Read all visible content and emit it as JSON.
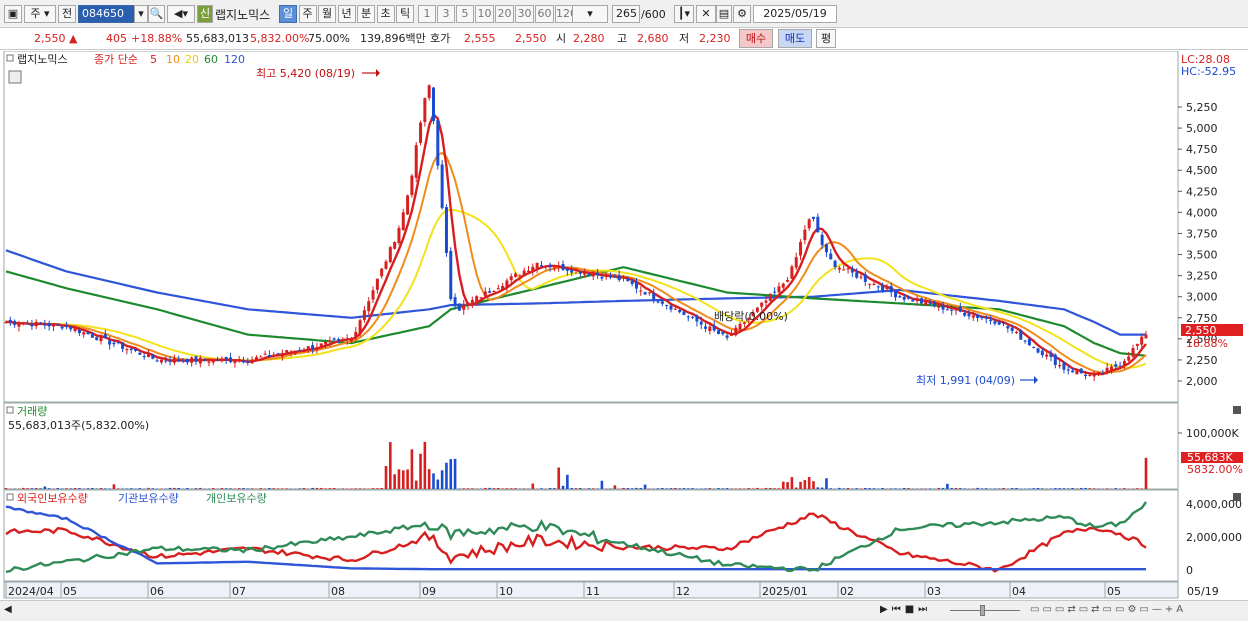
{
  "toolbar": {
    "market": "주",
    "prev": "전",
    "stock_code": "084650",
    "new_badge": "신",
    "stock_name": "랩지노믹스",
    "periods": [
      "일",
      "주",
      "월",
      "년",
      "분",
      "초",
      "틱"
    ],
    "selected_period": "일",
    "intervals": [
      "1",
      "3",
      "5",
      "10",
      "20",
      "30",
      "60",
      "120"
    ],
    "count": "265",
    "count_max": "/600",
    "date": "2025/05/19"
  },
  "quote": {
    "price": "2,550",
    "arrow": "▲",
    "change": "405",
    "change_pct": "+18.88%",
    "volume": "55,683,013",
    "volume_pct": "5,832.00%",
    "ratio": "75.00%",
    "amount": "139,896백만",
    "bid_label": "호가",
    "bid1": "2,555",
    "bid2": "2,550",
    "open_label": "시",
    "open": "2,280",
    "high_label": "고",
    "high": "2,680",
    "low_label": "저",
    "low": "2,230",
    "buy_label": "매수",
    "sell_label": "매도",
    "avg_label": "평"
  },
  "price_panel": {
    "stock_label": "랩지노믹스",
    "series_label": "종가 단순",
    "ma_labels": [
      "5",
      "10",
      "20",
      "60",
      "120"
    ],
    "lc": "LC:28.08",
    "hc": "HC:-52.95",
    "high_annot": "최고 5,420 (08/19)",
    "low_annot": "최저 1,991 (04/09)",
    "div_annot": "배당락(0.00%)",
    "current_price_tag": "2,550",
    "current_pct_tag": "18.88%",
    "y_ticks": [
      "5,250",
      "5,000",
      "4,750",
      "4,500",
      "4,250",
      "4,000",
      "3,750",
      "3,500",
      "3,250",
      "3,000",
      "2,750",
      "2,500",
      "2,250",
      "2,000"
    ]
  },
  "volume_panel": {
    "label": "거래량",
    "value_label": "55,683,013주(5,832.00%)",
    "y_tick": "100,000K",
    "tag_value": "55,683K",
    "tag_pct": "5832.00%"
  },
  "holding_panel": {
    "labels": [
      "외국인보유수량",
      "기관보유수량",
      "개인보유수량"
    ],
    "y_ticks": [
      "4,000,000",
      "2,000,000",
      "0"
    ]
  },
  "x_axis": {
    "labels": [
      "2024/04",
      "05",
      "06",
      "07",
      "08",
      "09",
      "10",
      "11",
      "12",
      "2025/01",
      "02",
      "03",
      "04",
      "05"
    ],
    "right_label": "05/19"
  },
  "colors": {
    "up": "#d81f1f",
    "down": "#1a4ccf",
    "ma5": "#d81f1f",
    "ma10": "#f08c1a",
    "ma20": "#f2e21a",
    "ma60": "#1e8a2e",
    "ma120": "#2f55d8",
    "foreign": "#d81f1f",
    "institution": "#2f55d8",
    "individual": "#2e8b57"
  },
  "chart_data": {
    "type": "candlestick",
    "x": [
      "2024/04",
      "2024/05",
      "2024/06",
      "2024/07",
      "2024/08",
      "2024/08/19",
      "2024/09",
      "2024/10",
      "2024/11",
      "2024/12",
      "2025/01",
      "2025/02",
      "2025/03",
      "2025/04",
      "2025/04/09",
      "2025/05",
      "2025/05/19"
    ],
    "close": [
      2700,
      2650,
      2250,
      2250,
      2500,
      4600,
      2800,
      3400,
      3200,
      2500,
      3500,
      3000,
      2700,
      2150,
      2050,
      2200,
      2550
    ],
    "ma120": [
      3550,
      3300,
      3050,
      2850,
      2750,
      2850,
      2900,
      2920,
      2950,
      2980,
      3000,
      3080,
      2950,
      2850,
      2700,
      2550,
      2550
    ],
    "ma60": [
      3300,
      3100,
      2850,
      2550,
      2450,
      2650,
      2850,
      3100,
      3350,
      3050,
      2980,
      2920,
      2850,
      2650,
      2450,
      2330,
      2300
    ],
    "high_point": {
      "date": "08/19",
      "value": 5420
    },
    "low_point": {
      "date": "04/09",
      "value": 1991
    },
    "ylim": [
      1900,
      5400
    ],
    "volume_ylim": [
      0,
      130000
    ],
    "holdings": {
      "series": [
        {
          "name": "외국인보유수량",
          "values": [
            2300000,
            2400000,
            800000,
            1300000,
            600000,
            2000000,
            800000,
            1800000,
            1400000,
            1300000,
            3400000,
            1000000,
            0,
            2200000,
            2600000,
            2200000,
            1500000
          ]
        },
        {
          "name": "기관보유수량",
          "values": [
            3800000,
            3100000,
            400000,
            500000,
            100000,
            50000,
            50000,
            50000,
            50000,
            50000,
            50000,
            50000,
            50000,
            50000,
            50000,
            50000,
            50000
          ]
        },
        {
          "name": "개인보유수량",
          "values": [
            0,
            500000,
            1300000,
            1200000,
            2000000,
            2800000,
            2200000,
            2700000,
            1600000,
            300000,
            0,
            2500000,
            2900000,
            3200000,
            2600000,
            2800000,
            4000000
          ]
        }
      ],
      "ylim": [
        -300000,
        4500000
      ]
    }
  }
}
